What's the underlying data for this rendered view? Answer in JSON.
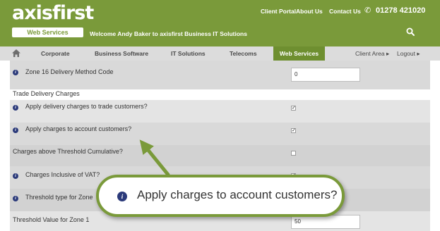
{
  "brand": {
    "logo_text": "axisfirst",
    "logo_sub": "Web Services",
    "welcome": "Welcome Andy Baker to axisfirst Business IT Solutions",
    "accent": "#7a9a3a",
    "info_color": "#2b3a7a"
  },
  "top_links": [
    "Client Portal",
    "About Us",
    "Contact Us"
  ],
  "phone": "01278 421020",
  "nav": {
    "items": [
      "Corporate",
      "Business Software",
      "IT Solutions",
      "Telecoms",
      "Web Services"
    ],
    "active": "Web Services",
    "client_area": "Client Area ▸",
    "logout": "Logout ▸"
  },
  "form": {
    "zone16_label": "Zone 16 Delivery Method Code",
    "zone16_value": "0",
    "section_trade": "Trade Delivery Charges",
    "apply_trade_label": "Apply delivery charges to trade customers?",
    "apply_trade_checked": true,
    "apply_account_label": "Apply charges to account customers?",
    "apply_account_checked": true,
    "threshold_cumulative_label": "Charges above Threshold Cumulative?",
    "threshold_cumulative_checked": false,
    "inclusive_vat_label": "Charges Inclusive of VAT?",
    "inclusive_vat_checked": true,
    "threshold_type_label": "Threshold type for Zone",
    "threshold_value_label": "Threshold Value for Zone 1",
    "threshold_value": "50"
  },
  "callout": {
    "text": "Apply charges to account customers?"
  }
}
